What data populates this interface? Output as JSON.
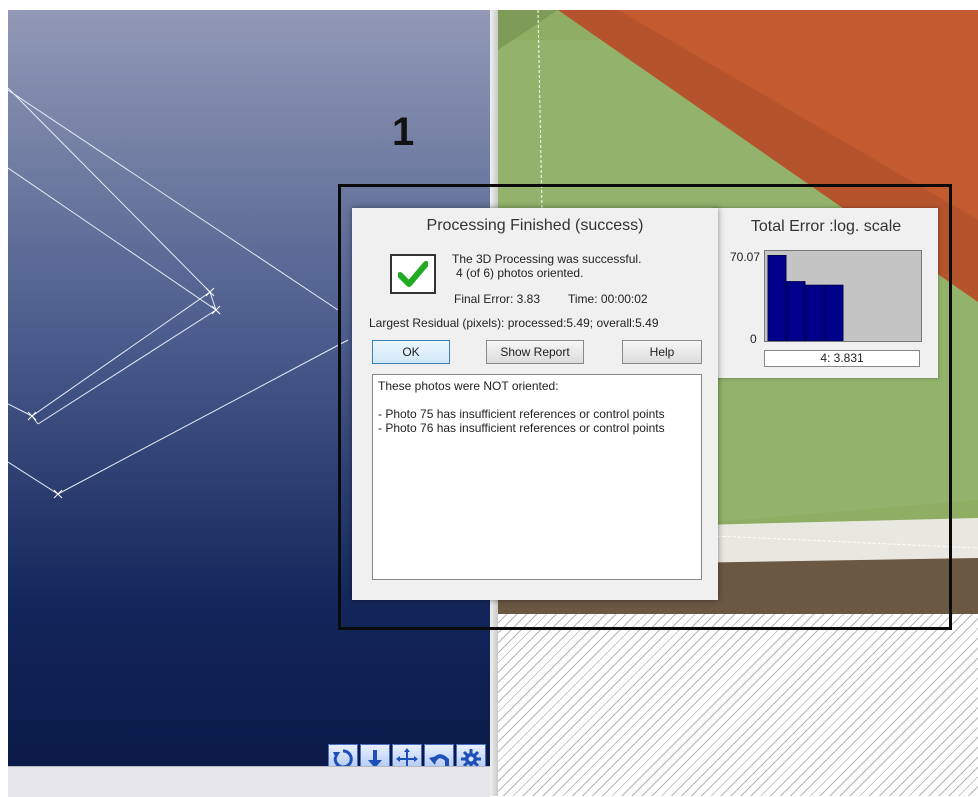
{
  "annotation": {
    "number": "1"
  },
  "dialog": {
    "title": "Processing Finished (success)",
    "status_line1": "The 3D Processing was successful.",
    "status_line2": "4 (of 6) photos oriented.",
    "final_error": "Final Error:  3.83",
    "time": "Time: 00:00:02",
    "largest_residual": "Largest Residual (pixels): processed:5.49; overall:5.49",
    "buttons": {
      "ok": "OK",
      "show_report": "Show Report",
      "help": "Help"
    },
    "messages": {
      "header": "These photos were NOT oriented:",
      "lines": [
        "- Photo 75 has insufficient references or control points",
        "- Photo 76 has insufficient references or control points"
      ]
    }
  },
  "error_panel": {
    "title": "Total Error :log. scale",
    "y_max_label": "70.07",
    "y_min_label": "0",
    "readout": "4:  3.831"
  },
  "chart_data": {
    "type": "bar",
    "title": "Total Error :log. scale",
    "yscale": "log",
    "ylim": [
      0,
      70.07
    ],
    "values_height_fraction": [
      0.95,
      0.66,
      0.62,
      0.62
    ],
    "colors": {
      "bar": "#00008b",
      "plot_bg": "#c4c4c4"
    }
  },
  "nav_tools": [
    "rotate-icon",
    "move-down-icon",
    "pan-icon",
    "undo-icon",
    "settings-icon"
  ],
  "colors": {
    "bar": "#00008b",
    "check": "#22aa22",
    "annotation": "#0a0a0a"
  }
}
